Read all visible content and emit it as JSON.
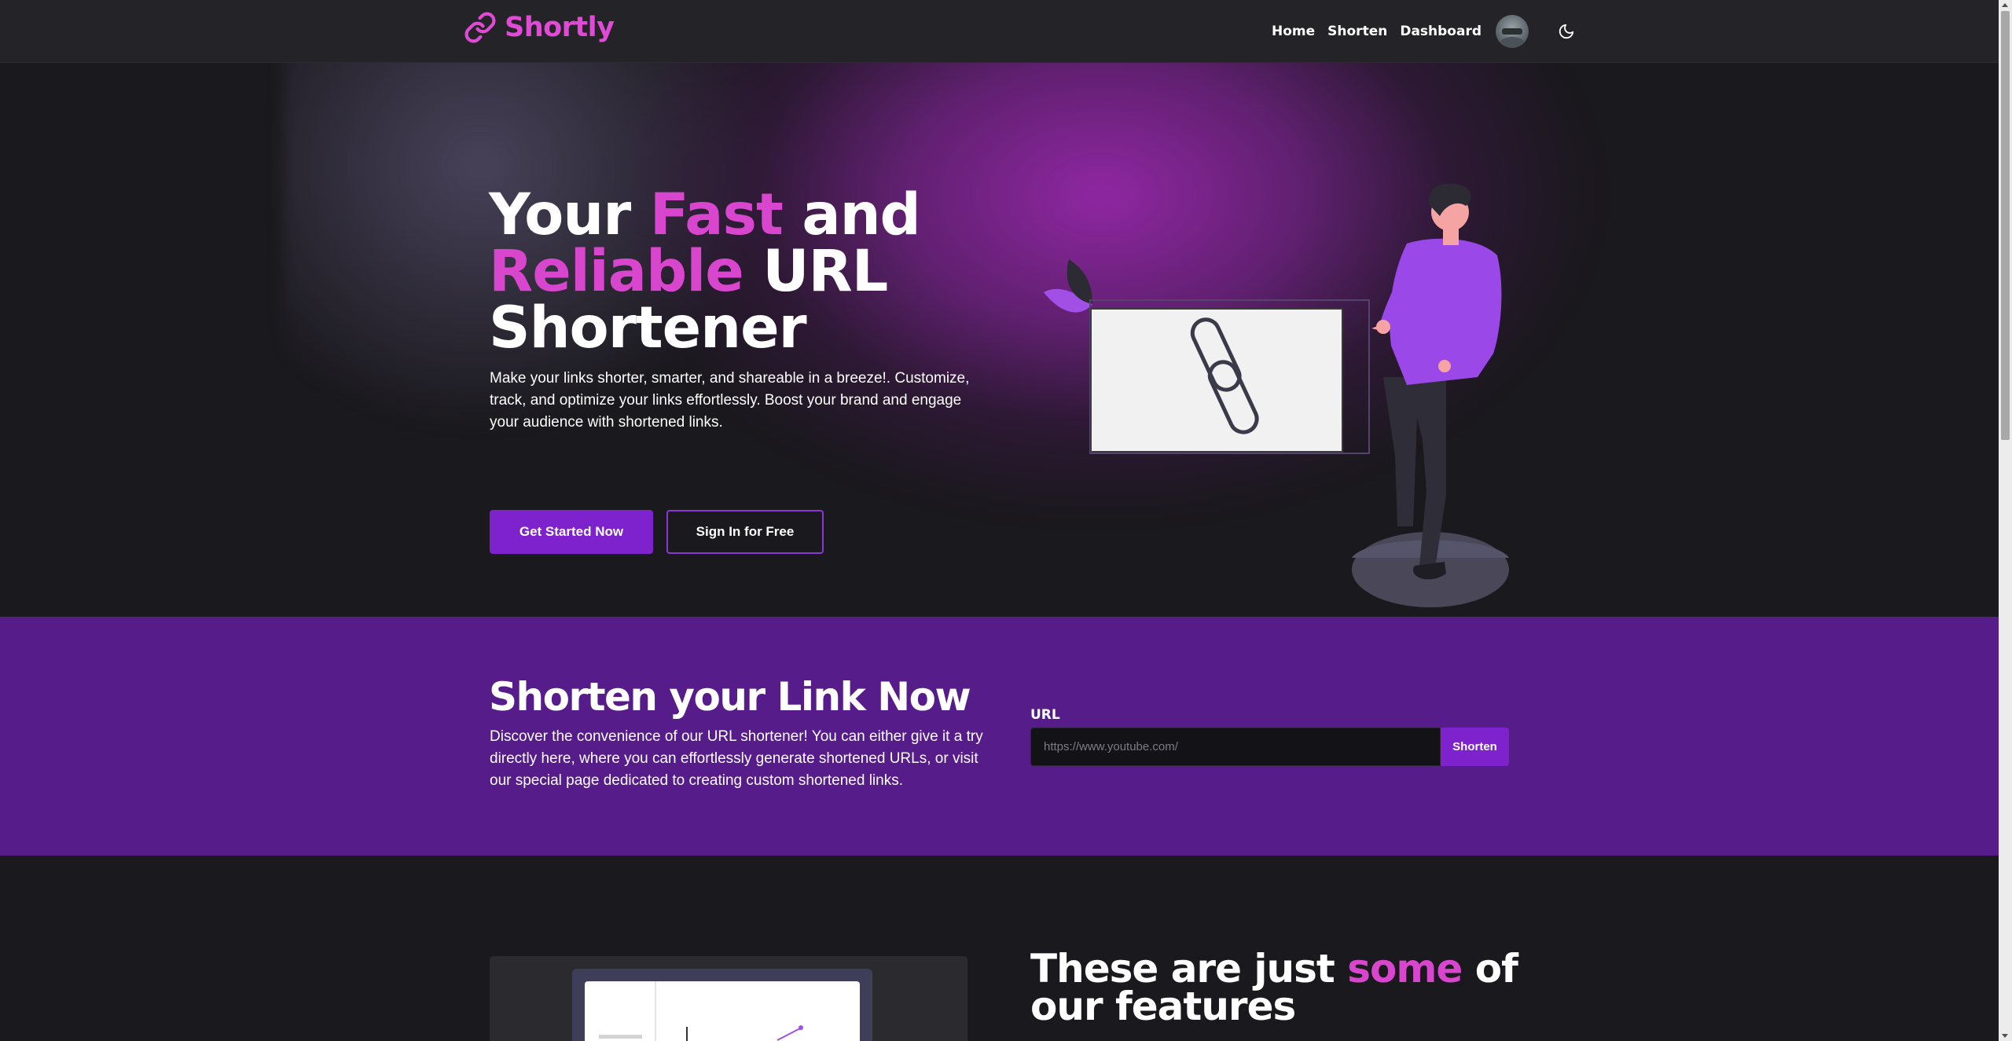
{
  "brand": {
    "name": "Shortly"
  },
  "nav": {
    "links": [
      "Home",
      "Shorten",
      "Dashboard"
    ]
  },
  "hero": {
    "title_part1": "Your ",
    "title_accent1": "Fast",
    "title_part2": " and ",
    "title_accent2": "Reliable",
    "title_part3": " URL Shortener",
    "description": "Make your links shorter, smarter, and shareable in a breeze!. Customize, track, and optimize your links effortlessly. Boost your brand and engage your audience with shortened links.",
    "primary_button": "Get Started Now",
    "secondary_button": "Sign In for Free"
  },
  "shorten": {
    "title": "Shorten your Link Now",
    "description": "Discover the convenience of our URL shortener! You can either give it a try directly here, where you can effortlessly generate shortened URLs, or visit our special page dedicated to creating custom shortened links.",
    "url_label": "URL",
    "url_placeholder": "https://www.youtube.com/",
    "submit_label": "Shorten"
  },
  "features": {
    "title_part1": "These are just ",
    "title_accent": "some",
    "title_part2": " of our features"
  },
  "colors": {
    "accent": "#d946ce",
    "primary_button": "#7e22ce",
    "section_purple": "#561c8a",
    "background": "#1a191d"
  },
  "icons": [
    "link-icon",
    "moon-icon",
    "user-avatar"
  ]
}
